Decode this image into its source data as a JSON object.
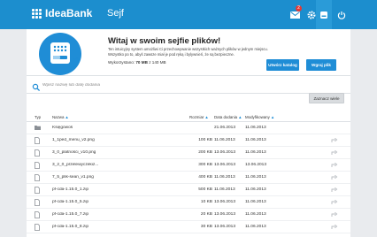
{
  "header": {
    "brand": "IdeaBank",
    "title": "Sejf",
    "mail_badge": "2",
    "colors": {
      "bar": "#1c8ece",
      "accent": "#1f8dd6"
    }
  },
  "hero": {
    "title": "Witaj w swoim sejfie plików!",
    "desc_lines": [
      "Ten intuicyjny system umożliwi Ci przechowywanie wszystkich ważnych plików w jednym miejscu.",
      "Wszystko po to, abyś zawsze miał je pod ręką i bylywnień, że są bezpieczne."
    ],
    "space_label": "Wykorzystano:",
    "space_value": "70 MB",
    "space_total": "z 140 MB",
    "progress_label": "50%",
    "progress_fraction": 0.5,
    "btn_catalog": "Utwórz katalog",
    "btn_upload": "Wgraj plik"
  },
  "search": {
    "placeholder": "Wpisz nazwę lub datę dodania"
  },
  "toolbar": {
    "select_all": "Zaznacz wiele"
  },
  "table": {
    "headers": {
      "type": "Typ",
      "name": "Nazwa",
      "size": "Rozmiar",
      "added": "Data dodania",
      "modified": "Modyfikowany"
    },
    "rows": [
      {
        "kind": "folder",
        "name": "Księgowoś",
        "size": "",
        "added": "21.06.2013",
        "modified": "11.06.2013"
      },
      {
        "kind": "file",
        "name": "1_1ped_menu_v2.png",
        "size": "100 KB",
        "added": "11.06.2013",
        "modified": "11.06.2013"
      },
      {
        "kind": "file",
        "name": "3_0_platnosci_v10.png",
        "size": "200 KB",
        "added": "13.06.2013",
        "modified": "11.06.2013"
      },
      {
        "kind": "file",
        "name": "3_2_0_przelewyczekiz...",
        "size": "300 KB",
        "added": "13.06.2013",
        "modified": "13.06.2013"
      },
      {
        "kind": "file",
        "name": "7_5_plik-sean_v1.png",
        "size": "400 KB",
        "added": "11.06.2013",
        "modified": "11.06.2013"
      },
      {
        "kind": "file",
        "name": "pf-cda-1.15.0_1.zip",
        "size": "500 KB",
        "added": "11.06.2013",
        "modified": "11.06.2013"
      },
      {
        "kind": "file",
        "name": "pf-cda-1.15.0_5.zip",
        "size": "10 KB",
        "added": "13.06.2013",
        "modified": "11.06.2013"
      },
      {
        "kind": "file",
        "name": "pf-cda-1.15.0_7.zip",
        "size": "20 KB",
        "added": "13.06.2013",
        "modified": "11.06.2013"
      },
      {
        "kind": "file",
        "name": "pf-cda-1.15.0_8.zip",
        "size": "30 KB",
        "added": "13.06.2013",
        "modified": "11.06.2013"
      }
    ]
  }
}
